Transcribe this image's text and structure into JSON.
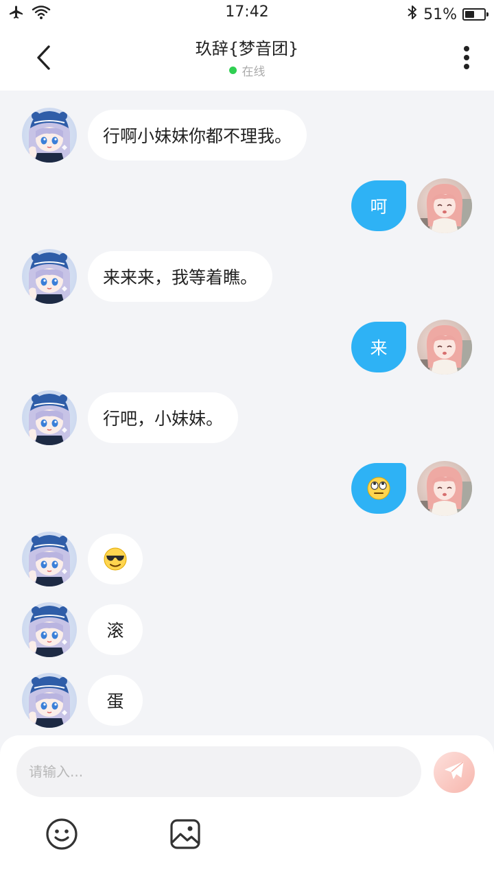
{
  "status_bar": {
    "time": "17:42",
    "battery_text": "51%",
    "battery_level": 0.51,
    "icons": [
      "airplane-icon",
      "wifi-icon",
      "bluetooth-icon",
      "battery-icon"
    ]
  },
  "header": {
    "title": "玖辞{梦音团}",
    "status": "在线",
    "status_color": "#2fcf52"
  },
  "messages": [
    {
      "side": "in",
      "type": "text",
      "text": "行啊小妹妹你都不理我。"
    },
    {
      "side": "out",
      "type": "text",
      "text": "呵"
    },
    {
      "side": "in",
      "type": "text",
      "text": "来来来，我等着瞧。"
    },
    {
      "side": "out",
      "type": "text",
      "text": "来"
    },
    {
      "side": "in",
      "type": "text",
      "text": "行吧，小妹妹。"
    },
    {
      "side": "out",
      "type": "emoji",
      "emoji": "eye-roll-emoji"
    },
    {
      "side": "in",
      "type": "emoji",
      "emoji": "sunglasses-emoji"
    },
    {
      "side": "in",
      "type": "text",
      "text": "滚"
    },
    {
      "side": "in",
      "type": "text",
      "text": "蛋"
    }
  ],
  "composer": {
    "placeholder": "请输入...",
    "value": ""
  },
  "colors": {
    "outgoing_bubble": "#2eb2f5",
    "incoming_bubble": "#ffffff",
    "background": "#f3f4f7",
    "send_button": "#f7b6ad"
  }
}
